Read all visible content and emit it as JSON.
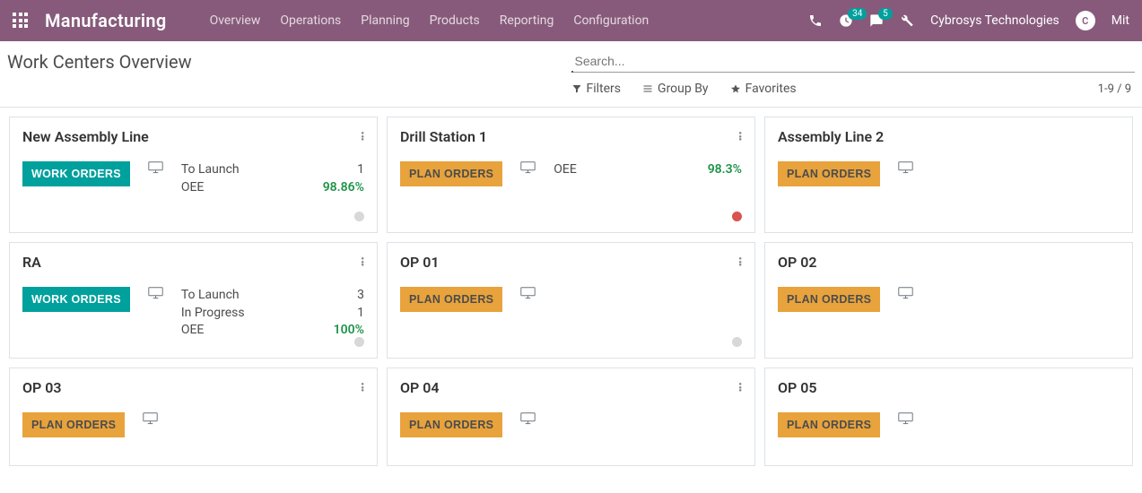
{
  "topnav": {
    "app_title": "Manufacturing",
    "menu": [
      "Overview",
      "Operations",
      "Planning",
      "Products",
      "Reporting",
      "Configuration"
    ],
    "badge_activities": "34",
    "badge_messages": "5",
    "company": "Cybrosys Technologies",
    "user_short": "Mit"
  },
  "cp": {
    "title": "Work Centers Overview",
    "search_placeholder": "Search...",
    "filters": "Filters",
    "groupby": "Group By",
    "favorites": "Favorites",
    "pager": "1-9 / 9"
  },
  "labels": {
    "work_orders_btn": "WORK ORDERS",
    "plan_orders_btn": "PLAN ORDERS",
    "to_launch": "To Launch",
    "in_progress": "In Progress",
    "oee": "OEE"
  },
  "cards": [
    {
      "title": "New Assembly Line",
      "btn": "work",
      "hasMenu": true,
      "dot": "grey",
      "stats": [
        [
          "to_launch",
          "1"
        ],
        [
          "oee",
          "98.86%",
          "green"
        ]
      ]
    },
    {
      "title": "Drill Station 1",
      "btn": "plan",
      "hasMenu": true,
      "dot": "red",
      "stats": [
        [
          "oee",
          "98.3%",
          "green"
        ]
      ]
    },
    {
      "title": "Assembly Line 2",
      "btn": "plan",
      "hasMenu": false,
      "dot": null,
      "stats": []
    },
    {
      "title": "RA",
      "btn": "work",
      "hasMenu": true,
      "dot": "grey",
      "stats": [
        [
          "to_launch",
          "3"
        ],
        [
          "in_progress",
          "1"
        ],
        [
          "oee",
          "100%",
          "green"
        ]
      ]
    },
    {
      "title": "OP 01",
      "btn": "plan",
      "hasMenu": true,
      "dot": "grey",
      "stats": []
    },
    {
      "title": "OP 02",
      "btn": "plan",
      "hasMenu": false,
      "dot": null,
      "stats": []
    },
    {
      "title": "OP 03",
      "btn": "plan",
      "hasMenu": true,
      "dot": null,
      "short": true,
      "stats": []
    },
    {
      "title": "OP 04",
      "btn": "plan",
      "hasMenu": true,
      "dot": null,
      "short": true,
      "stats": []
    },
    {
      "title": "OP 05",
      "btn": "plan",
      "hasMenu": false,
      "dot": null,
      "short": true,
      "stats": []
    }
  ]
}
